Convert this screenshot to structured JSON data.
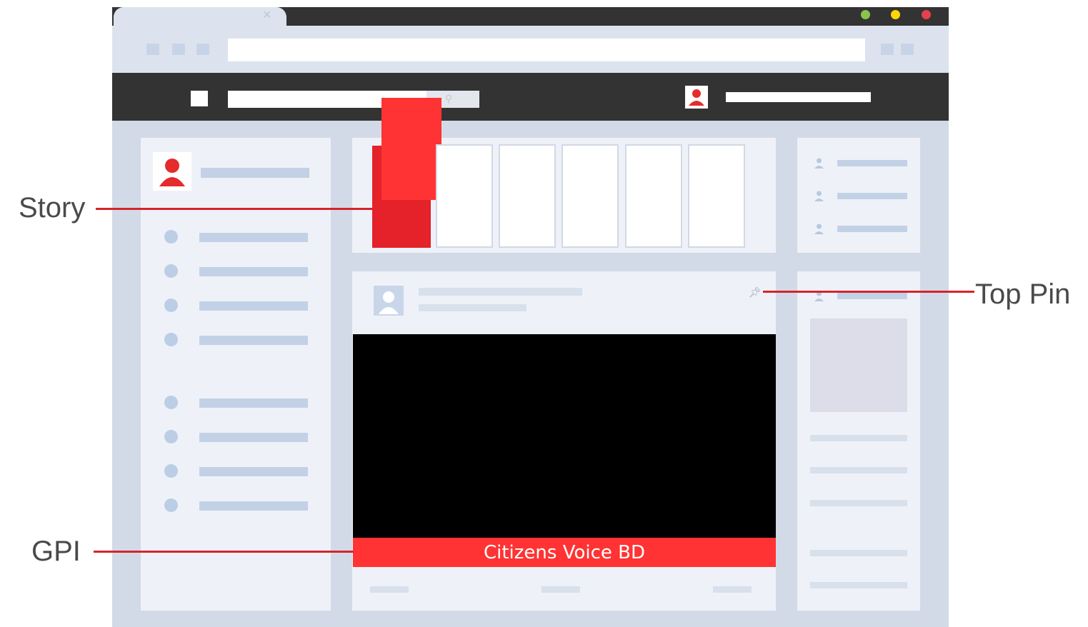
{
  "labels": {
    "story": "Story",
    "top_pin": "Top Pin",
    "gpi": "GPI"
  },
  "post": {
    "banner_text": "Citizens Voice BD"
  },
  "colors": {
    "accent_red": "#ff3333",
    "annotation_line": "#d6242a",
    "frame": "#d3dae7",
    "panel": "#eef2f8",
    "nav_dark": "#333333",
    "placeholder_bar": "#c3d1e6",
    "window_green": "#8bc34a",
    "window_yellow": "#ffd600",
    "window_red": "#e5404b"
  },
  "icons": [
    "close-icon",
    "search-icon",
    "user-avatar-icon",
    "pin-icon",
    "person-icon"
  ]
}
